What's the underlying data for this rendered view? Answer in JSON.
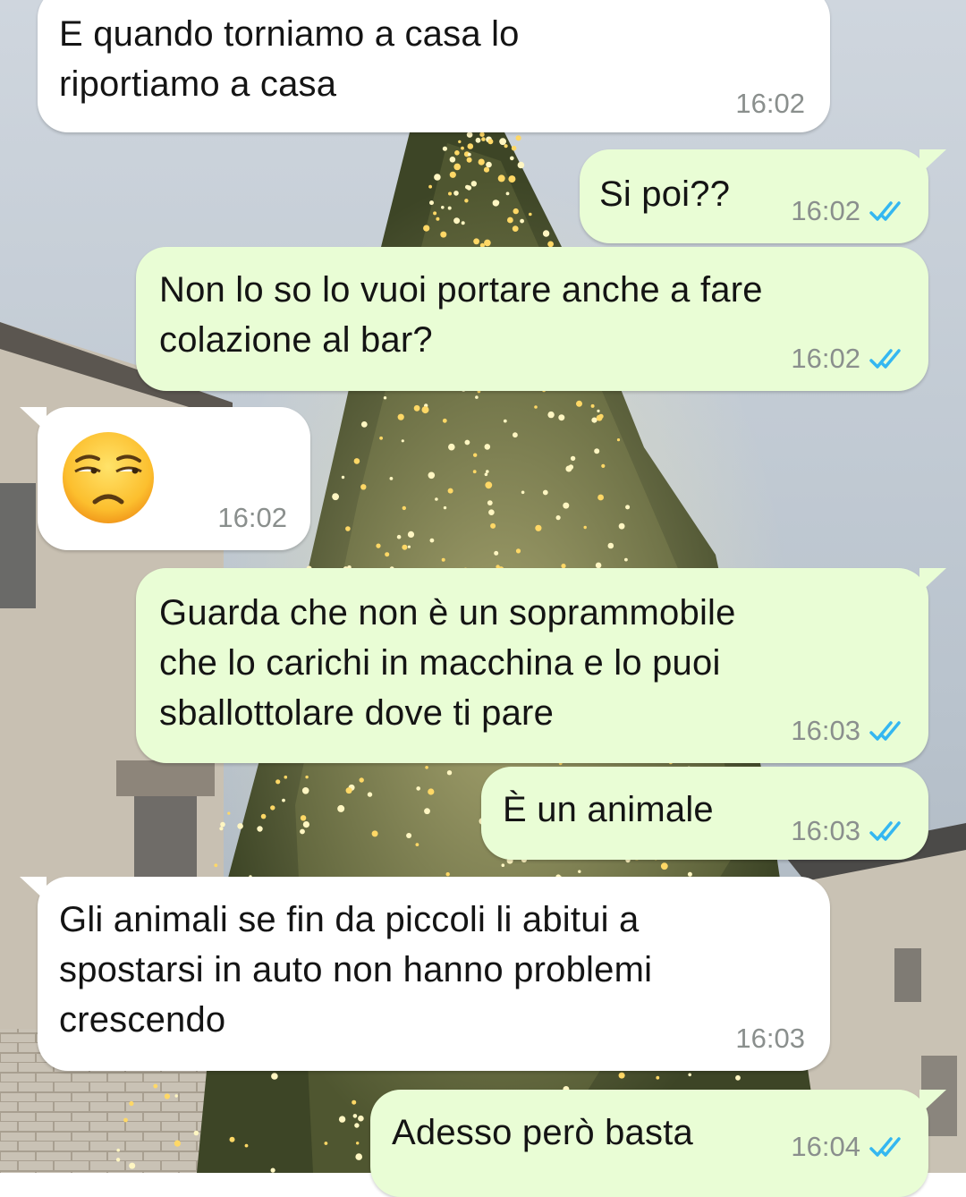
{
  "conversation": {
    "messages": [
      {
        "direction": "incoming",
        "text": "E quando torniamo a casa lo\nriportiamo a casa",
        "time": "16:02"
      },
      {
        "direction": "outgoing",
        "text": "Si poi??",
        "time": "16:02",
        "status": "read"
      },
      {
        "direction": "outgoing",
        "text": "Non lo so lo vuoi portare anche a fare\ncolazione al bar?",
        "time": "16:02",
        "status": "read"
      },
      {
        "direction": "incoming",
        "emoji": "unamused-face",
        "time": "16:02"
      },
      {
        "direction": "outgoing",
        "text": "Guarda che non è un soprammobile\nche lo carichi in macchina e lo puoi\nsballottolare dove ti pare",
        "time": "16:03",
        "status": "read"
      },
      {
        "direction": "outgoing",
        "text": "È un animale",
        "time": "16:03",
        "status": "read"
      },
      {
        "direction": "incoming",
        "text": "Gli animali se fin da piccoli li abitui a\nspostarsi in auto non hanno problemi\ncrescendo",
        "time": "16:03"
      },
      {
        "direction": "outgoing",
        "text": "Adesso però basta",
        "time": "16:04",
        "status": "read"
      }
    ]
  },
  "colors": {
    "incoming_bubble": "#ffffff",
    "outgoing_bubble": "#e9fdd5",
    "read_ticks": "#34b7f1",
    "timestamp": "#8a8f8d"
  },
  "icons": {
    "read_receipt": "double-check-icon",
    "wallpaper": "christmas-tree-photo"
  }
}
